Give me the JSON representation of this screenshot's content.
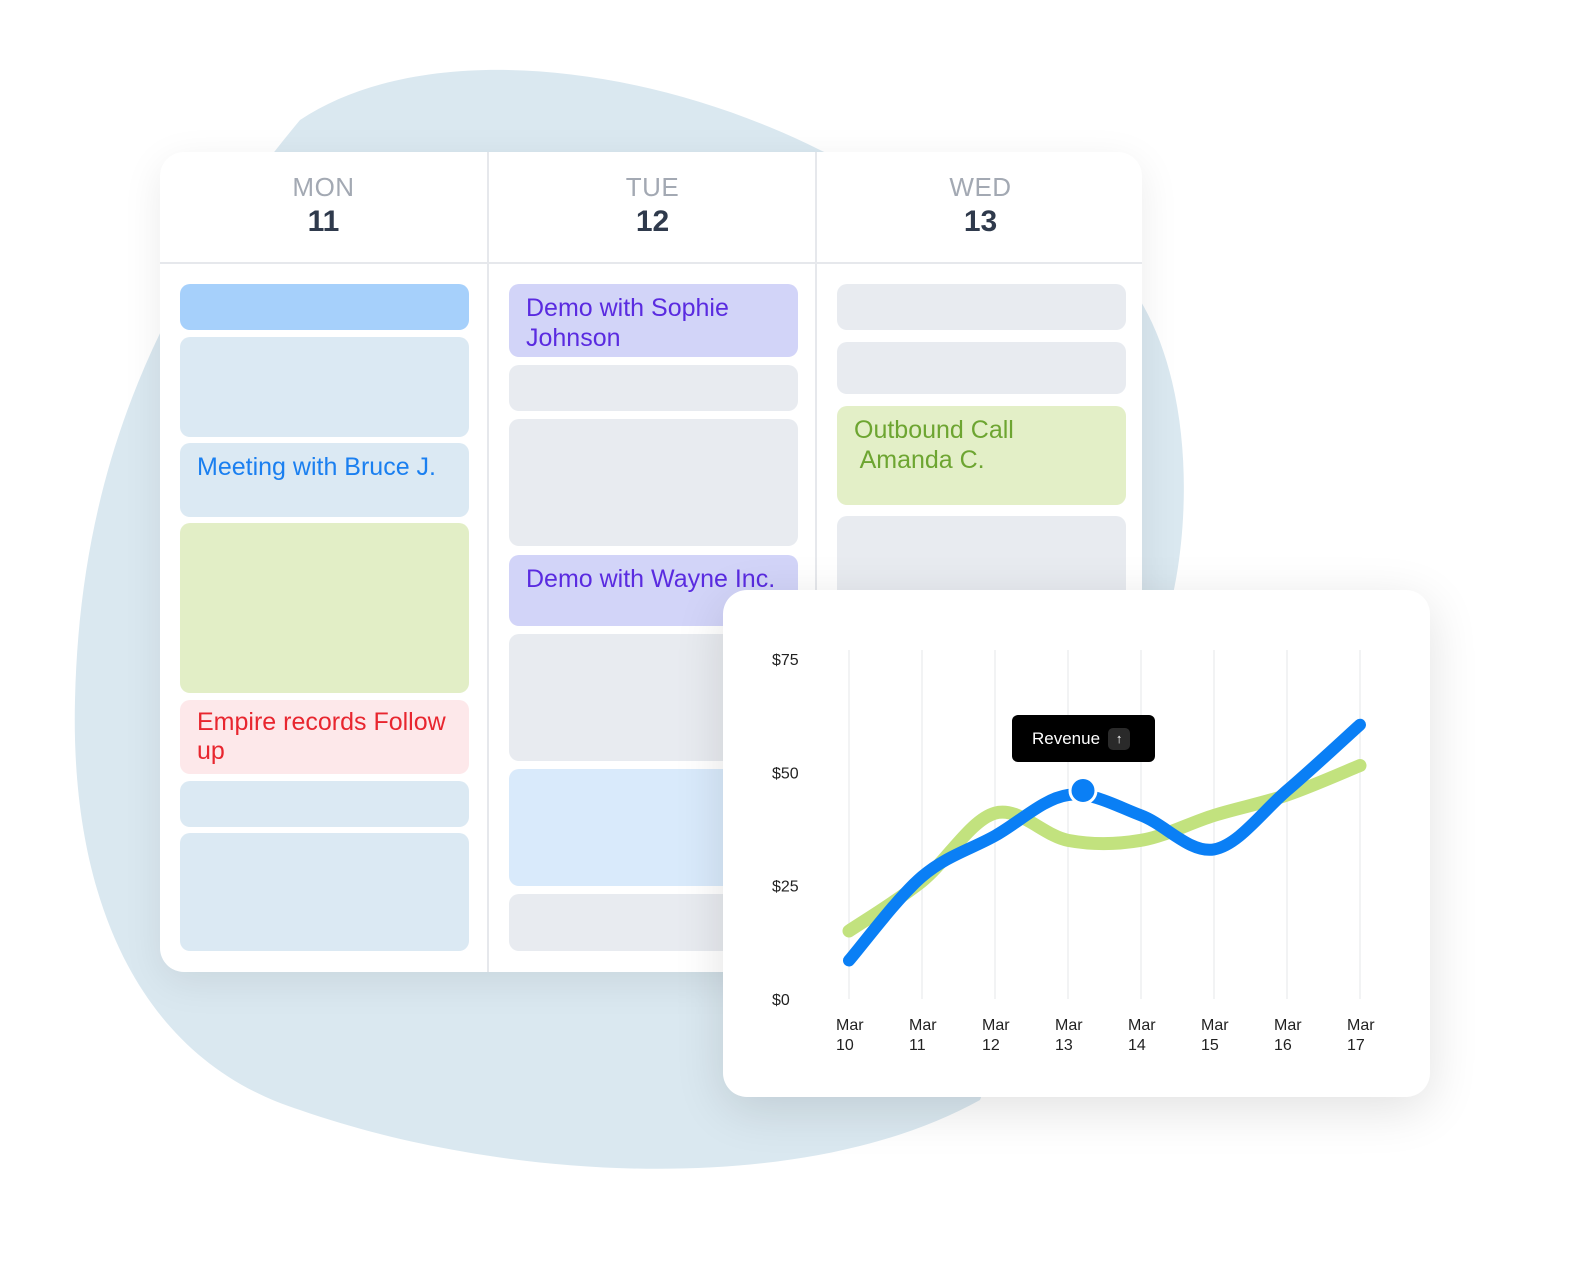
{
  "calendar": {
    "days": [
      {
        "dow": "MON",
        "date": "11"
      },
      {
        "dow": "TUE",
        "date": "12"
      },
      {
        "dow": "WED",
        "date": "13"
      }
    ],
    "events": {
      "mon": [
        "Meeting with Bruce J.",
        "Empire records Follow up"
      ],
      "tue": [
        "Demo with Sophie Johnson",
        "Demo with Wayne Inc."
      ],
      "wed": [
        "Outbound Call\n Amanda C."
      ]
    }
  },
  "colors": {
    "blue_event_text": "#1a7ff0",
    "purple_event_text": "#5a2be0",
    "red_event_text": "#e8262f",
    "green_event_text": "#6da531",
    "blue_line": "#0a7ff5",
    "green_line": "#c2e27e"
  },
  "tooltip": {
    "label": "Revenue",
    "icon": "arrow-up-icon"
  },
  "chart_data": {
    "type": "line",
    "categories": [
      "Mar 10",
      "Mar 11",
      "Mar 12",
      "Mar 13",
      "Mar 14",
      "Mar 15",
      "Mar 16",
      "Mar 17"
    ],
    "x_labels": [
      [
        "Mar",
        "10"
      ],
      [
        "Mar",
        "11"
      ],
      [
        "Mar",
        "12"
      ],
      [
        "Mar",
        "13"
      ],
      [
        "Mar",
        "14"
      ],
      [
        "Mar",
        "15"
      ],
      [
        "Mar",
        "16"
      ],
      [
        "Mar",
        "17"
      ]
    ],
    "y_ticks": [
      "$0",
      "$25",
      "$50",
      "$75"
    ],
    "ylim": [
      0,
      75
    ],
    "grid": "vertical",
    "series": [
      {
        "color": "#0a7ff5",
        "values": [
          8.5,
          27,
          36,
          45,
          40.5,
          33,
          46,
          60.5
        ],
        "highlight_index": 3
      },
      {
        "color": "#c2e27e",
        "values": [
          15,
          26,
          41,
          35,
          35,
          40.5,
          45,
          51.5
        ]
      }
    ]
  }
}
